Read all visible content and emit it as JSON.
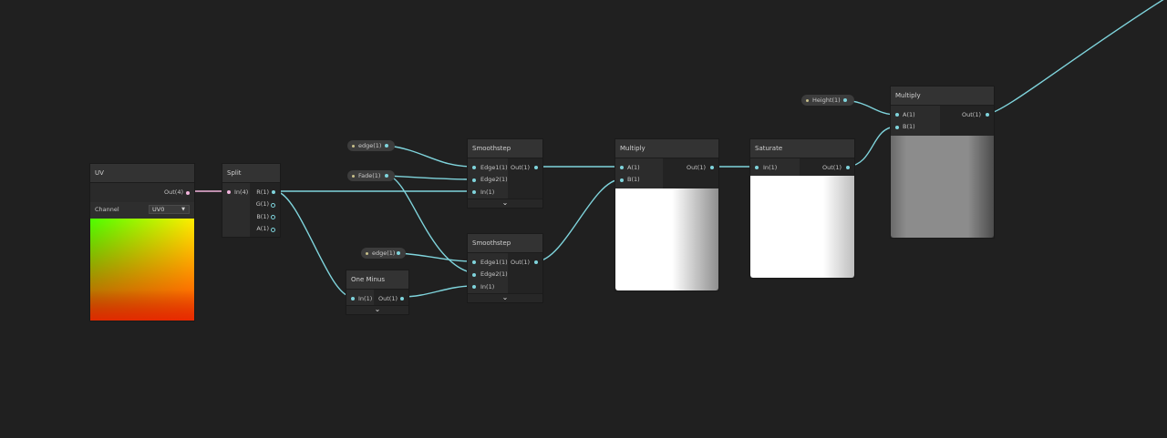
{
  "colors": {
    "wire": "#7fd4dc",
    "wire_pink": "#f2b4dc",
    "background": "#202020"
  },
  "uv_node": {
    "title": "UV",
    "output": "Out(4)",
    "channel_label": "Channel",
    "channel_value": "UV0"
  },
  "split_node": {
    "title": "Split",
    "input": "In(4)",
    "outputs": [
      "R(1)",
      "G(1)",
      "B(1)",
      "A(1)"
    ]
  },
  "properties": {
    "edge_top": "edge(1)",
    "fade": "Fade(1)",
    "edge_bottom": "edge(1)",
    "height": "Height(1)"
  },
  "smoothstep_top": {
    "title": "Smoothstep",
    "inputs": [
      "Edge1(1)",
      "Edge2(1)",
      "In(1)"
    ],
    "output": "Out(1)"
  },
  "smoothstep_bottom": {
    "title": "Smoothstep",
    "inputs": [
      "Edge1(1)",
      "Edge2(1)",
      "In(1)"
    ],
    "output": "Out(1)"
  },
  "one_minus": {
    "title": "One Minus",
    "input": "In(1)",
    "output": "Out(1)"
  },
  "multiply_1": {
    "title": "Multiply",
    "inputs": [
      "A(1)",
      "B(1)"
    ],
    "output": "Out(1)"
  },
  "saturate": {
    "title": "Saturate",
    "input": "In(1)",
    "output": "Out(1)"
  },
  "multiply_2": {
    "title": "Multiply",
    "inputs": [
      "A(1)",
      "B(1)"
    ],
    "output": "Out(1)"
  },
  "icons": {
    "expand": "chevron-down-icon",
    "dropdown": "triangle-down-icon"
  }
}
